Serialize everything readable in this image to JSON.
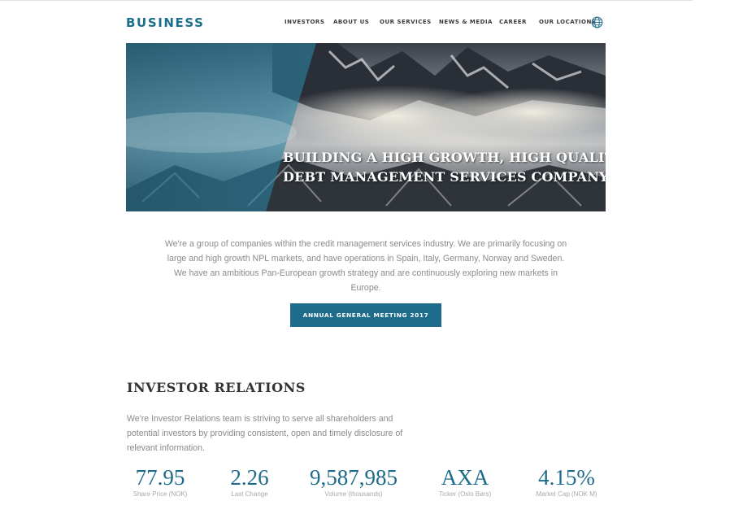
{
  "brand": {
    "logo_text": "BUSINESS",
    "accent_color": "#1d6b8a"
  },
  "nav": {
    "items": [
      "INVESTORS",
      "ABOUT US",
      "OUR SERVICES",
      "NEWS & MEDIA",
      "CAREER",
      "OUR LOCATIONS"
    ],
    "locations_icon": "globe-icon"
  },
  "hero": {
    "line1": "BUILDING A HIGH GROWTH, HIGH QUALITY",
    "line2": "DEBT MANAGEMENT SERVICES COMPANY",
    "image": "mountain-landscape-with-clouds"
  },
  "intro": {
    "text": "We're a group of companies within the credit management services industry. We are primarily focusing on large and high growth NPL markets, and have operations in Spain, Italy, Germany, Norway and Sweden. We have an ambitious Pan-European growth strategy and are continuously exploring new markets in Europe."
  },
  "cta": {
    "label": "ANNUAL GENERAL MEETING 2017"
  },
  "investor_relations": {
    "title": "INVESTOR RELATIONS",
    "text": "We're Investor Relations team is striving to serve all shareholders and potential investors by providing consistent, open and timely disclosure of relevant information."
  },
  "stats": [
    {
      "value": "77.95",
      "label": "Share Price (NOK)"
    },
    {
      "value": "2.26",
      "label": "Last Change"
    },
    {
      "value": "9,587,985",
      "label": "Volume (thousands)"
    },
    {
      "value": "AXA",
      "label": "Ticker (Oslo Børs)"
    },
    {
      "value": "4.15%",
      "label": "Market Cap (NOK M)"
    }
  ]
}
